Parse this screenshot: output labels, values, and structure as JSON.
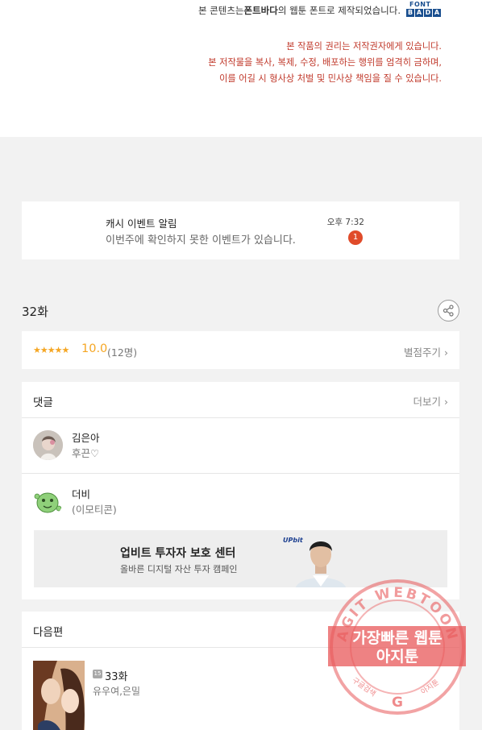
{
  "font_notice": {
    "prefix": "본 콘텐츠는 ",
    "brand": "폰트바다",
    "suffix": "의 웹툰 폰트로 제작되었습니다.",
    "logo_line1": "FONT",
    "logo_letters": [
      "B",
      "A",
      "D",
      "A"
    ]
  },
  "rights_notice": [
    "본 작품의 권리는 저작권자에게 있습니다.",
    "본 저작물을 복사, 복제, 수정, 배포하는 행위를 엄격히 금하며,",
    "이를 어길 시 형사상 처벌 및 민사상 책임을 질 수 있습니다."
  ],
  "notification": {
    "title": "캐시 이벤트 알림",
    "body": "이번주에 확인하지 못한 이벤트가 있습니다.",
    "time": "오후 7:32",
    "badge": "1"
  },
  "episode": {
    "title": "32화",
    "share_icon": "share-icon"
  },
  "rating": {
    "stars": "★★★★★",
    "score": "10.0",
    "count": "(12명)",
    "rate_label": "별점주기 ›"
  },
  "comments": {
    "title": "댓글",
    "more_label": "더보기 ›",
    "items": [
      {
        "name": "김은아",
        "text": "후끈♡"
      },
      {
        "name": "더비",
        "text": "(이모티콘)"
      }
    ]
  },
  "ad": {
    "title": "업비트 투자자 보호 센터",
    "subtitle": "올바른 디지털 자산 투자 캠페인",
    "brand": "UPbit"
  },
  "next_episode": {
    "title": "다음편",
    "age_badge": "15",
    "episode_title": "33화",
    "authors": "유우여,은밀"
  },
  "watermark": {
    "ring_text": "AGIT WEBTOON",
    "band_line1": "가장빠른 웹툰",
    "band_line2": "아지툰",
    "bottom_left": "구글검색",
    "bottom_right": "아지툰",
    "google": "G"
  },
  "colors": {
    "accent_star": "#f5a623",
    "rights_text": "#c0392b",
    "badge": "#e04b2a",
    "stamp": "#e8585a",
    "upbit": "#1b3e8f"
  }
}
